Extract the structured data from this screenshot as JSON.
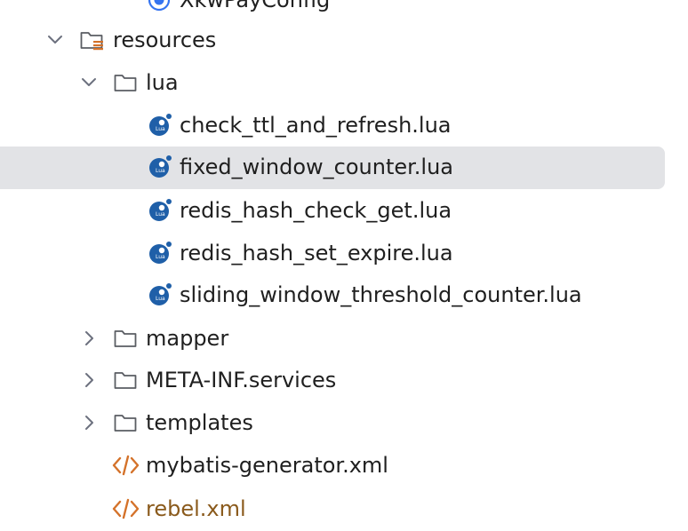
{
  "tree": {
    "partial_top_item": {
      "label": "XkwPayConfig",
      "icon": "config-class-icon"
    },
    "resources": {
      "label": "resources",
      "icon": "resources-folder-icon",
      "expanded": true
    },
    "lua": {
      "label": "lua",
      "icon": "folder-icon",
      "expanded": true
    },
    "lua_files": [
      {
        "label": "check_ttl_and_refresh.lua",
        "icon": "lua-file-icon"
      },
      {
        "label": "fixed_window_counter.lua",
        "icon": "lua-file-icon",
        "selected": true
      },
      {
        "label": "redis_hash_check_get.lua",
        "icon": "lua-file-icon"
      },
      {
        "label": "redis_hash_set_expire.lua",
        "icon": "lua-file-icon"
      },
      {
        "label": "sliding_window_threshold_counter.lua",
        "icon": "lua-file-icon"
      }
    ],
    "folders": [
      {
        "label": "mapper",
        "icon": "folder-icon",
        "expanded": false
      },
      {
        "label": "META-INF.services",
        "icon": "folder-icon",
        "expanded": false
      },
      {
        "label": "templates",
        "icon": "folder-icon",
        "expanded": false
      }
    ],
    "xml_files": [
      {
        "label": "mybatis-generator.xml",
        "icon": "xml-file-icon"
      },
      {
        "label": "rebel.xml",
        "icon": "xml-file-icon"
      }
    ]
  },
  "colors": {
    "selection": "#e2e3e6",
    "xml_icon": "#d4722a",
    "lua_icon": "#1f5fa8",
    "folder_stroke": "#5a5d63",
    "config_icon": "#3574f0"
  }
}
